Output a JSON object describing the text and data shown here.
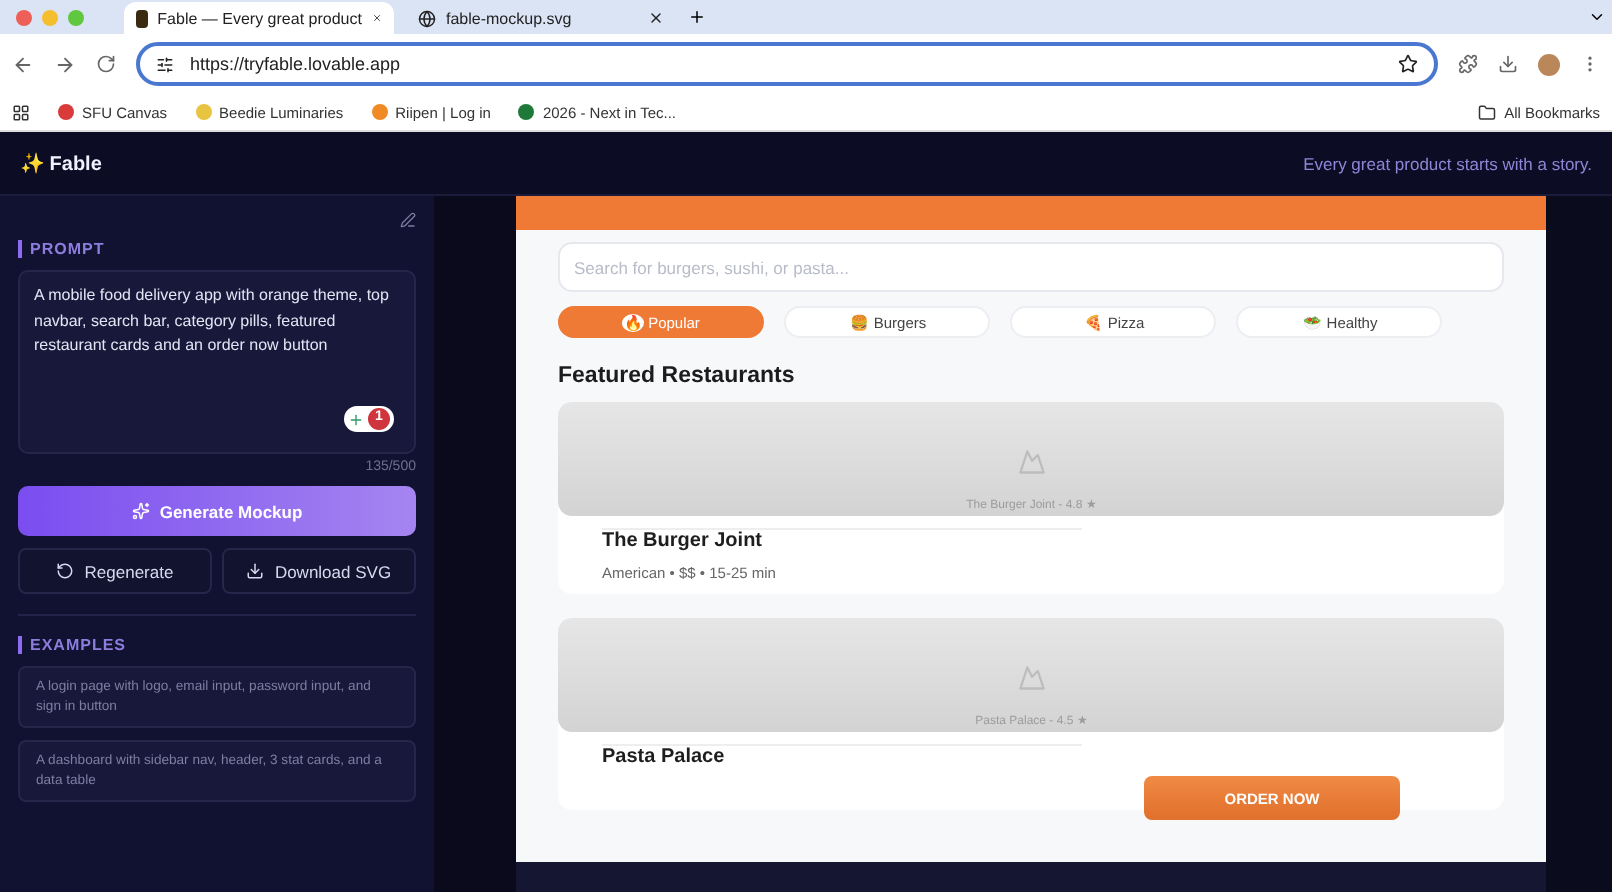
{
  "browser": {
    "tabs": [
      {
        "title": "Fable — Every great product",
        "selected": true,
        "kind": "app"
      },
      {
        "title": "fable-mockup.svg",
        "selected": false,
        "kind": "globe"
      }
    ],
    "address": "https://tryfable.lovable.app",
    "bookmarks": [
      {
        "label": "SFU Canvas",
        "color": "#d93a3a"
      },
      {
        "label": "Beedie Luminaries",
        "color": "#e8c440"
      },
      {
        "label": "Riipen | Log in",
        "color": "#f08a24"
      },
      {
        "label": "2026 - Next in Tec...",
        "color": "#1f7a3a"
      }
    ],
    "all_bookmarks": "All Bookmarks"
  },
  "app": {
    "logo": "✨ Fable",
    "tagline": "Every great product starts with a story."
  },
  "sidebar": {
    "prompt_heading": "PROMPT",
    "prompt": "A mobile food delivery app with orange theme, top navbar, search bar, category pills, featured restaurant cards and an order now button",
    "grammar_count": "1",
    "char_count": "135/500",
    "generate": "Generate Mockup",
    "regenerate": "Regenerate",
    "download": "Download SVG",
    "examples_heading": "EXAMPLES",
    "examples": [
      "A login page with logo, email input, password input, and sign in button",
      "A dashboard with sidebar nav, header, 3 stat cards, and a data table"
    ]
  },
  "mockup": {
    "search": {
      "placeholder": "Search for burgers, sushi, or pasta..."
    },
    "pills": [
      {
        "icon": "🔥",
        "label": "Popular",
        "selected": true
      },
      {
        "icon": "🍔",
        "label": "Burgers",
        "selected": false
      },
      {
        "icon": "🍕",
        "label": "Pizza",
        "selected": false
      },
      {
        "icon": "🥗",
        "label": "Healthy",
        "selected": false
      }
    ],
    "section": "Featured Restaurants",
    "cards": [
      {
        "caption": "The Burger Joint - 4.8 ★",
        "name": "The Burger Joint",
        "meta": "American • $$ • 15-25 min"
      },
      {
        "caption": "Pasta Palace - 4.5 ★",
        "name": "Pasta Palace"
      }
    ],
    "order": "ORDER NOW"
  }
}
